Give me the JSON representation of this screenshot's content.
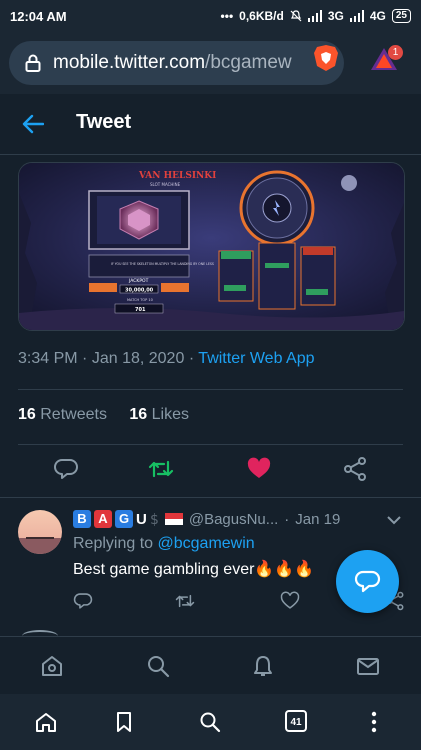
{
  "status_bar": {
    "time": "12:04 AM",
    "dots": "•••",
    "speed": "0,6KB/d",
    "net1": "3G",
    "net2": "4G",
    "battery": "25"
  },
  "browser": {
    "url_host": "mobile.twitter.com",
    "url_path": "/bcgamew",
    "rewards_badge": "1",
    "tabs_count": "41"
  },
  "header": {
    "title": "Tweet"
  },
  "tweet": {
    "time": "3:34 PM",
    "separator": "·",
    "date": "Jan 18, 2020",
    "source": "Twitter Web App",
    "retweets_count": "16",
    "retweets_label": "Retweets",
    "likes_count": "16",
    "likes_label": "Likes",
    "liked": true,
    "media": {
      "game_title": "VAN HELSINKI",
      "game_subtitle": "SLOT MACHINE",
      "prompt": "IF YOU SEE THE SKELETON MULTIPLY THE LANDING BY ONE LESS",
      "jackpot_label": "JACKPOT",
      "jackpot_value": "30,000,00",
      "spin_label": "MATCH TOP 10",
      "bet_value": "701"
    }
  },
  "reply": {
    "name_letters": [
      "B",
      "A",
      "G",
      "U"
    ],
    "handle": "@BagusNu...",
    "separator": "·",
    "date": "Jan 19",
    "replying_prefix": "Replying to",
    "replying_mention": "@bcgamewin",
    "text": "Best game gambling ever🔥🔥🔥"
  },
  "colors": {
    "accent": "#1da1f2",
    "like": "#e0245e",
    "retweet": "#17bf63",
    "background": "#15202b"
  },
  "icons": {
    "back": "back-arrow-icon",
    "reply": "reply-icon",
    "retweet": "retweet-icon",
    "like": "heart-icon",
    "share": "share-icon",
    "compose": "compose-icon",
    "home": "home-icon",
    "search": "search-icon",
    "notifications": "bell-icon",
    "messages": "mail-icon"
  }
}
